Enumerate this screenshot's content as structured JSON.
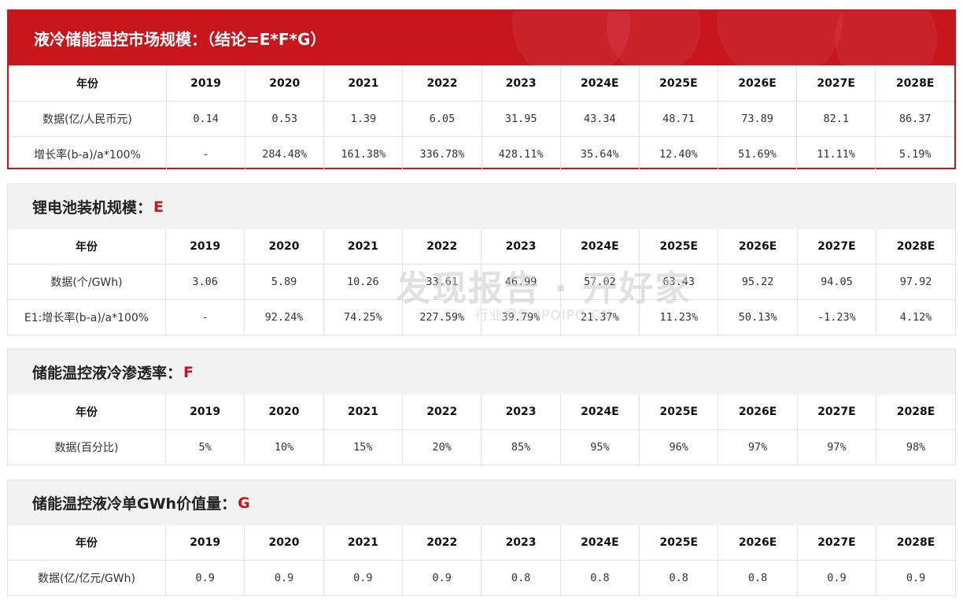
{
  "main": {
    "title": "液冷储能温控市场规模：（结论=E*F*G）",
    "years": [
      "2019",
      "2020",
      "2021",
      "2022",
      "2023",
      "2024E",
      "2025E",
      "2026E",
      "2027E",
      "2028E"
    ],
    "header_label": "年份",
    "rows": [
      {
        "label": "数据(亿/人民币元)",
        "values": [
          "0.14",
          "0.53",
          "1.39",
          "6.05",
          "31.95",
          "43.34",
          "48.71",
          "73.89",
          "82.1",
          "86.37"
        ]
      },
      {
        "label": "增长率(b-a)/a*100%",
        "values": [
          "-",
          "284.48%",
          "161.38%",
          "336.78%",
          "428.11%",
          "35.64%",
          "12.40%",
          "51.69%",
          "11.11%",
          "5.19%"
        ]
      }
    ]
  },
  "lithium": {
    "title": "锂电池装机规模：",
    "letter": "E",
    "header_label": "年份",
    "years": [
      "2019",
      "2020",
      "2021",
      "2022",
      "2023",
      "2024E",
      "2025E",
      "2026E",
      "2027E",
      "2028E"
    ],
    "rows": [
      {
        "label": "数据(个/GWh)",
        "values": [
          "3.06",
          "5.89",
          "10.26",
          "33.61",
          "46.99",
          "57.02",
          "63.43",
          "95.22",
          "94.05",
          "97.92"
        ]
      },
      {
        "label": "E1:增长率(b-a)/a*100%",
        "values": [
          "-",
          "92.24%",
          "74.25%",
          "227.59%",
          "39.79%",
          "21.37%",
          "11.23%",
          "50.13%",
          "-1.23%",
          "4.12%"
        ]
      }
    ]
  },
  "penetration": {
    "title": "储能温控液冷渗透率：",
    "letter": "F",
    "header_label": "年份",
    "years": [
      "2019",
      "2020",
      "2021",
      "2022",
      "2023",
      "2024E",
      "2025E",
      "2026E",
      "2027E",
      "2028E"
    ],
    "rows": [
      {
        "label": "数据(百分比)",
        "values": [
          "5%",
          "10%",
          "15%",
          "20%",
          "85%",
          "95%",
          "96%",
          "97%",
          "97%",
          "98%"
        ]
      }
    ]
  },
  "unit_value": {
    "title": "储能温控液冷单GWh价值量：",
    "letter": "G",
    "header_label": "年份",
    "years": [
      "2019",
      "2020",
      "2021",
      "2022",
      "2023",
      "2024E",
      "2025E",
      "2026E",
      "2027E",
      "2028E"
    ],
    "rows": [
      {
        "label": "数据(亿/亿元/GWh)",
        "values": [
          "0.9",
          "0.9",
          "0.9",
          "0.9",
          "0.8",
          "0.8",
          "0.8",
          "0.8",
          "0.9",
          "0.9"
        ]
      }
    ]
  },
  "watermark": {
    "main": "发现报告 · 开好家",
    "sub": "行业报告 IPOIPO.CN"
  },
  "colors": {
    "accent": "#c8161d",
    "header_bg": "#f2f2f2",
    "border": "#e3e3e3"
  }
}
